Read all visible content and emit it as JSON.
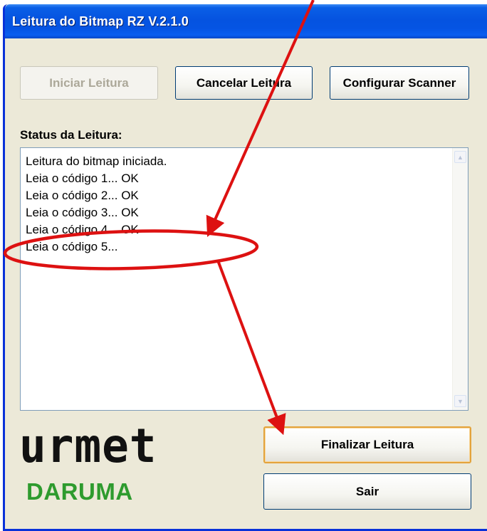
{
  "window": {
    "title": "Leitura do Bitmap RZ V.2.1.0"
  },
  "toolbar": {
    "start_label": "Iniciar Leitura",
    "cancel_label": "Cancelar Leitura",
    "config_label": "Configurar Scanner"
  },
  "status": {
    "heading": "Status da Leitura:",
    "lines": [
      "Leitura do bitmap iniciada.",
      "Leia o código 1... OK",
      "Leia o código 2... OK",
      "Leia o código 3... OK",
      "Leia o código 4... OK",
      "Leia o código 5..."
    ]
  },
  "actions": {
    "finish_label": "Finalizar Leitura",
    "exit_label": "Sair"
  },
  "logo": {
    "brand_top": "urmet",
    "brand_bottom": "DARUMA"
  },
  "colors": {
    "annotation": "#dd1111",
    "titlebar": "#0553e0",
    "daruma_green": "#2e9b2e"
  },
  "icons": {
    "scroll_up": "scroll-up-arrow-icon",
    "scroll_down": "scroll-down-arrow-icon"
  }
}
